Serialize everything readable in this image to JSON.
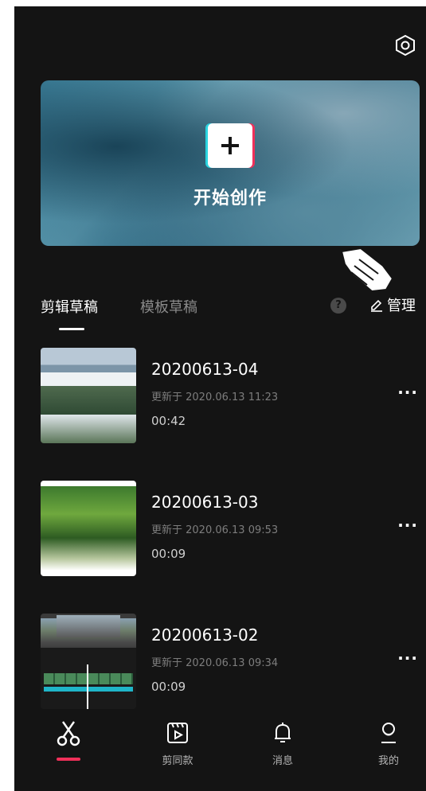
{
  "hero": {
    "label": "开始创作"
  },
  "tabs": {
    "active": "剪辑草稿",
    "inactive": "模板草稿"
  },
  "help": {
    "symbol": "?"
  },
  "manage": {
    "label": "管理"
  },
  "drafts": [
    {
      "title": "20200613-04",
      "updated": "更新于 2020.06.13 11:23",
      "duration": "00:42",
      "more": "···"
    },
    {
      "title": "20200613-03",
      "updated": "更新于 2020.06.13 09:53",
      "duration": "00:09",
      "more": "···"
    },
    {
      "title": "20200613-02",
      "updated": "更新于 2020.06.13 09:34",
      "duration": "00:09",
      "more": "···"
    }
  ],
  "nav": {
    "items": [
      {
        "icon": "scissors-icon",
        "label": ""
      },
      {
        "icon": "template-play-icon",
        "label": "剪同款"
      },
      {
        "icon": "bell-icon",
        "label": "消息"
      },
      {
        "icon": "profile-icon",
        "label": "我的"
      }
    ]
  },
  "colors": {
    "background": "#141414",
    "accent": "#f0305a",
    "cyan": "#2ad4e0"
  }
}
